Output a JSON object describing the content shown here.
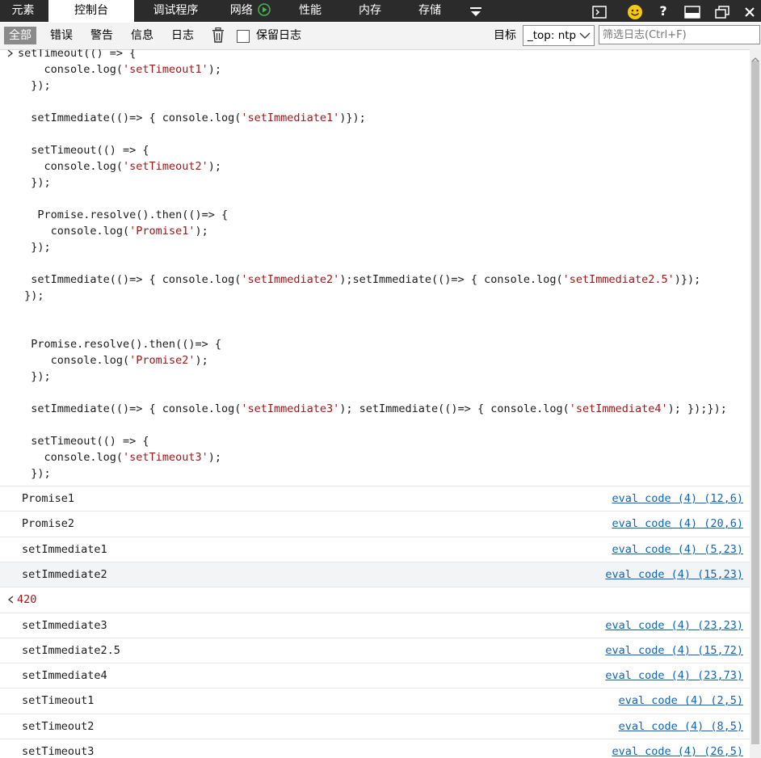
{
  "tabs": [
    {
      "label": "元素"
    },
    {
      "label": "控制台"
    },
    {
      "label": "调试程序"
    },
    {
      "label": "网络"
    },
    {
      "label": "性能"
    },
    {
      "label": "内存"
    },
    {
      "label": "存储"
    }
  ],
  "toolbar": {
    "filters": [
      "全部",
      "错误",
      "警告",
      "信息",
      "日志"
    ],
    "preserve_log_label": "保留日志",
    "target_label": "目标",
    "target_value": "_top: ntp",
    "filter_placeholder": "筛选日志(Ctrl+F)"
  },
  "input_code": [
    [
      {
        "t": "setTimeout(() => {"
      }
    ],
    [
      {
        "t": "    console.log("
      },
      {
        "t": "'setTimeout1'",
        "s": 1
      },
      {
        "t": ");"
      }
    ],
    [
      {
        "t": "  });"
      }
    ],
    [
      {
        "t": ""
      }
    ],
    [
      {
        "t": "  setImmediate(()=> { console.log("
      },
      {
        "t": "'setImmediate1'",
        "s": 1
      },
      {
        "t": ")});"
      }
    ],
    [
      {
        "t": ""
      }
    ],
    [
      {
        "t": "  setTimeout(() => {"
      }
    ],
    [
      {
        "t": "    console.log("
      },
      {
        "t": "'setTimeout2'",
        "s": 1
      },
      {
        "t": ");"
      }
    ],
    [
      {
        "t": "  });"
      }
    ],
    [
      {
        "t": ""
      }
    ],
    [
      {
        "t": "   Promise.resolve().then(()=> {"
      }
    ],
    [
      {
        "t": "     console.log("
      },
      {
        "t": "'Promise1'",
        "s": 1
      },
      {
        "t": ");"
      }
    ],
    [
      {
        "t": "  });"
      }
    ],
    [
      {
        "t": ""
      }
    ],
    [
      {
        "t": "  setImmediate(()=> { console.log("
      },
      {
        "t": "'setImmediate2'",
        "s": 1
      },
      {
        "t": ");setImmediate(()=> { console.log("
      },
      {
        "t": "'setImmediate2.5'",
        "s": 1
      },
      {
        "t": ")});"
      }
    ],
    [
      {
        "t": " });"
      }
    ],
    [
      {
        "t": ""
      }
    ],
    [
      {
        "t": ""
      }
    ],
    [
      {
        "t": "  Promise.resolve().then(()=> {"
      }
    ],
    [
      {
        "t": "     console.log("
      },
      {
        "t": "'Promise2'",
        "s": 1
      },
      {
        "t": ");"
      }
    ],
    [
      {
        "t": "  });"
      }
    ],
    [
      {
        "t": ""
      }
    ],
    [
      {
        "t": "  setImmediate(()=> { console.log("
      },
      {
        "t": "'setImmediate3'",
        "s": 1
      },
      {
        "t": "); setImmediate(()=> { console.log("
      },
      {
        "t": "'setImmediate4'",
        "s": 1
      },
      {
        "t": "); });});"
      }
    ],
    [
      {
        "t": ""
      }
    ],
    [
      {
        "t": "  setTimeout(() => {"
      }
    ],
    [
      {
        "t": "    console.log("
      },
      {
        "t": "'setTimeout3'",
        "s": 1
      },
      {
        "t": ");"
      }
    ],
    [
      {
        "t": "  });"
      }
    ]
  ],
  "output_rows": [
    {
      "type": "log",
      "message": "Promise1",
      "source": "eval code (4) (12,6)"
    },
    {
      "type": "log",
      "message": "Promise2",
      "source": "eval code (4) (20,6)"
    },
    {
      "type": "log",
      "message": "setImmediate1",
      "source": "eval code (4) (5,23)"
    },
    {
      "type": "log",
      "message": "setImmediate2",
      "source": "eval code (4) (15,23)",
      "hovered": true
    },
    {
      "type": "result",
      "message": "420",
      "source": ""
    },
    {
      "type": "log",
      "message": "setImmediate3",
      "source": "eval code (4) (23,23)"
    },
    {
      "type": "log",
      "message": "setImmediate2.5",
      "source": "eval code (4) (15,72)"
    },
    {
      "type": "log",
      "message": "setImmediate4",
      "source": "eval code (4) (23,73)"
    },
    {
      "type": "log",
      "message": "setTimeout1",
      "source": "eval code (4) (2,5)"
    },
    {
      "type": "log",
      "message": "setTimeout2",
      "source": "eval code (4) (8,5)"
    },
    {
      "type": "log",
      "message": "setTimeout3",
      "source": "eval code (4) (26,5)"
    }
  ],
  "colors": {
    "topbar_bg": "#2b2b2b",
    "string": "#a31515",
    "link": "#0b64c0",
    "result": "#a31515",
    "network_icon": "#3fb950"
  }
}
